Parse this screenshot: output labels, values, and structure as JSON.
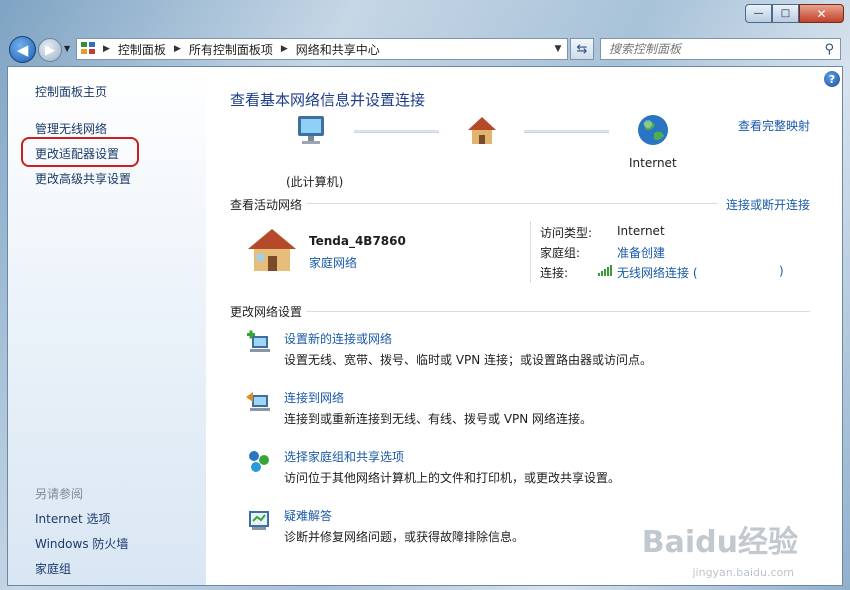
{
  "window": {
    "min_glyph": "—",
    "max_glyph": "□",
    "close_glyph": "✕"
  },
  "nav": {
    "back_glyph": "◀",
    "forward_glyph": "▶"
  },
  "address": {
    "crumbs": [
      "控制面板",
      "所有控制面板项",
      "网络和共享中心"
    ]
  },
  "search": {
    "placeholder": "搜索控制面板"
  },
  "sidebar": {
    "home": "控制面板主页",
    "items": [
      "管理无线网络",
      "更改适配器设置",
      "更改高级共享设置"
    ],
    "see_also_title": "另请参阅",
    "see_also": [
      "Internet 选项",
      "Windows 防火墙",
      "家庭组"
    ]
  },
  "main": {
    "title": "查看基本网络信息并设置连接",
    "full_map": "查看完整映射",
    "diagram": {
      "this_computer": "(此计算机)",
      "internet": "Internet"
    },
    "active_networks": {
      "header": "查看活动网络",
      "connect_disconnect": "连接或断开连接",
      "network_name": "Tenda_4B7860",
      "network_type": "家庭网络",
      "access_type_label": "访问类型:",
      "access_type_value": "Internet",
      "homegroup_label": "家庭组:",
      "homegroup_value": "准备创建",
      "connections_label": "连接:",
      "connection_value": "无线网络连接 (",
      "connection_close": ")"
    },
    "change_settings": {
      "header": "更改网络设置",
      "tasks": [
        {
          "link": "设置新的连接或网络",
          "desc": "设置无线、宽带、拨号、临时或 VPN 连接；或设置路由器或访问点。"
        },
        {
          "link": "连接到网络",
          "desc": "连接到或重新连接到无线、有线、拨号或 VPN 网络连接。"
        },
        {
          "link": "选择家庭组和共享选项",
          "desc": "访问位于其他网络计算机上的文件和打印机，或更改共享设置。"
        },
        {
          "link": "疑难解答",
          "desc": "诊断并修复网络问题，或获得故障排除信息。"
        }
      ]
    }
  },
  "help_glyph": "?",
  "watermark": {
    "text": "Baidu经验",
    "sub": "jingyan.baidu.com"
  },
  "colors": {
    "link": "#1a5aa8",
    "title": "#1e3d8a",
    "highlight_ring": "#cc1f1f"
  }
}
